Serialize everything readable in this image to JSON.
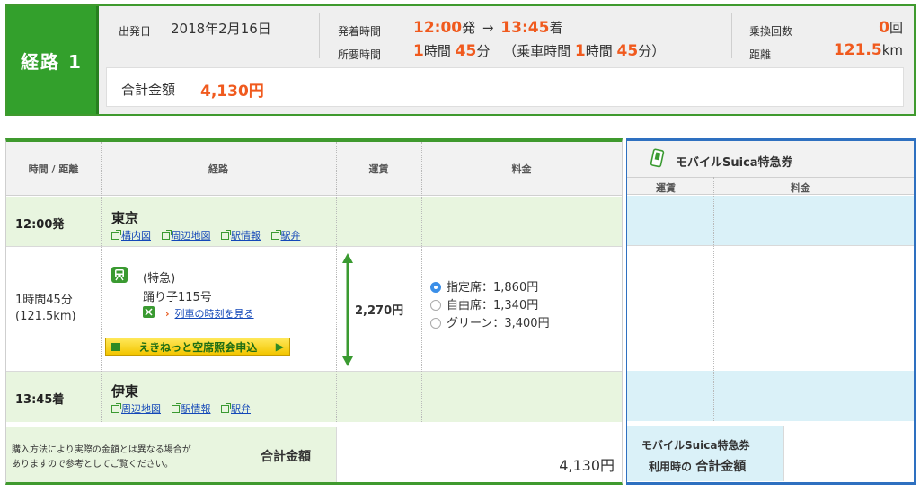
{
  "summary": {
    "route_label": "経路 1",
    "departure_date_label": "出発日",
    "departure_date": "2018年2月16日",
    "dep_arr_label": "発着時間",
    "dep_time": "12:00",
    "dep_suffix": "発",
    "arrow": "→",
    "arr_time": "13:45",
    "arr_suffix": "着",
    "duration_label": "所要時間",
    "duration_h": "1",
    "duration_h_unit": "時間",
    "duration_m": "45",
    "duration_m_unit": "分",
    "ride_open": "（乗車時間",
    "ride_h": "1",
    "ride_h_unit": "時間",
    "ride_m": "45",
    "ride_m_unit": "分）",
    "transfers_label": "乗換回数",
    "transfers_value": "0",
    "transfers_unit": "回",
    "distance_label": "距離",
    "distance_value": "121.5",
    "distance_unit": "km",
    "total_label": "合計金額",
    "total_value": "4,130円"
  },
  "table": {
    "headers": [
      "時間 / 距離",
      "経路",
      "運賃",
      "料金"
    ],
    "departure": {
      "time": "12:00発",
      "station": "東京",
      "links": [
        "構内図",
        "周辺地図",
        "駅情報",
        "駅弁"
      ]
    },
    "segment": {
      "duration": "1時間45分",
      "distance": "(121.5km)",
      "train_type": "(特急)",
      "train_name": "踊り子115号",
      "timetable_link": "列車の時刻を見る",
      "fare": "2,270円",
      "options": [
        "指定席：1,860円",
        "自由席：1,340円",
        "グリーン：3,400円"
      ],
      "reserve_button": "えきねっと空席照会申込"
    },
    "arrival": {
      "time": "13:45着",
      "station": "伊東",
      "links": [
        "周辺地図",
        "駅情報",
        "駅弁"
      ]
    },
    "footer": {
      "note_line1": "購入方法により実際の金額とは異なる場合が",
      "note_line2": "ありますので参考としてご覧ください。",
      "total_label": "合計金額",
      "total_value": "4,130円"
    }
  },
  "suica": {
    "title": "モバイルSuica特急券",
    "headers": [
      "運賃",
      "料金"
    ],
    "footer_line1": "モバイルSuica特急券",
    "footer_line2_prefix": "利用時の",
    "footer_line2_bold": "合計金額"
  },
  "colors": {
    "brand_green": "#33a02c",
    "price_orange": "#f05a1e",
    "link_blue": "#1448b8",
    "suica_blue": "#2e70c0"
  }
}
